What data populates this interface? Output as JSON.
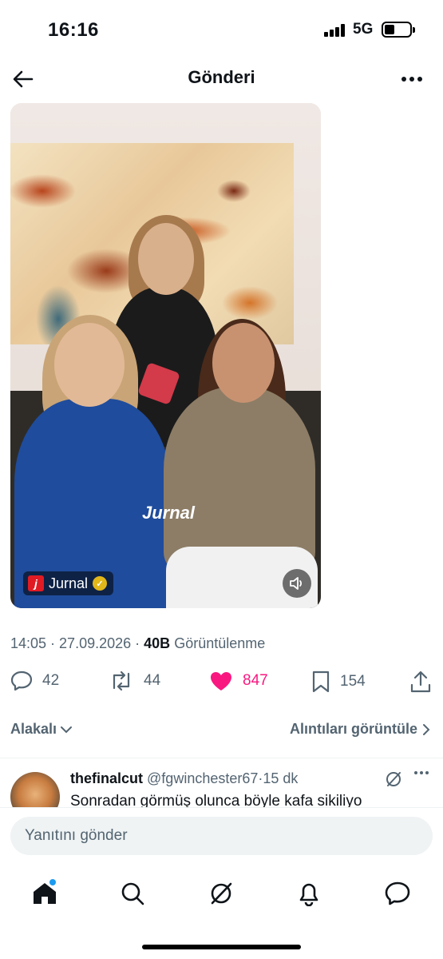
{
  "status_bar": {
    "time": "16:16",
    "network": "5G"
  },
  "header": {
    "title": "Gönderi"
  },
  "media": {
    "watermark": "Jurnal",
    "source_name": "Jurnal",
    "source_logo_letter": "j"
  },
  "meta": {
    "time": "14:05",
    "date": "27.09.2026",
    "views": "40B",
    "views_label": "Görüntülenme",
    "separator": " · "
  },
  "actions": {
    "replies": "42",
    "reposts": "44",
    "likes": "847",
    "bookmarks": "154",
    "like_color": "#f91880"
  },
  "relevance": {
    "sort_label": "Alakalı",
    "quotes_label": "Alıntıları görüntüle"
  },
  "reply": {
    "name": "thefinalcut",
    "handle": "@fgwinchester67",
    "time": "15 dk",
    "dot": "·",
    "text": "Sonradan görmüş olunca böyle kafa sikiliyo"
  },
  "composer": {
    "placeholder": "Yanıtını gönder"
  },
  "tabbar": [
    "home-icon",
    "search-icon",
    "grok-icon",
    "notifications-icon",
    "messages-icon"
  ],
  "accent": "#1d9bf0"
}
